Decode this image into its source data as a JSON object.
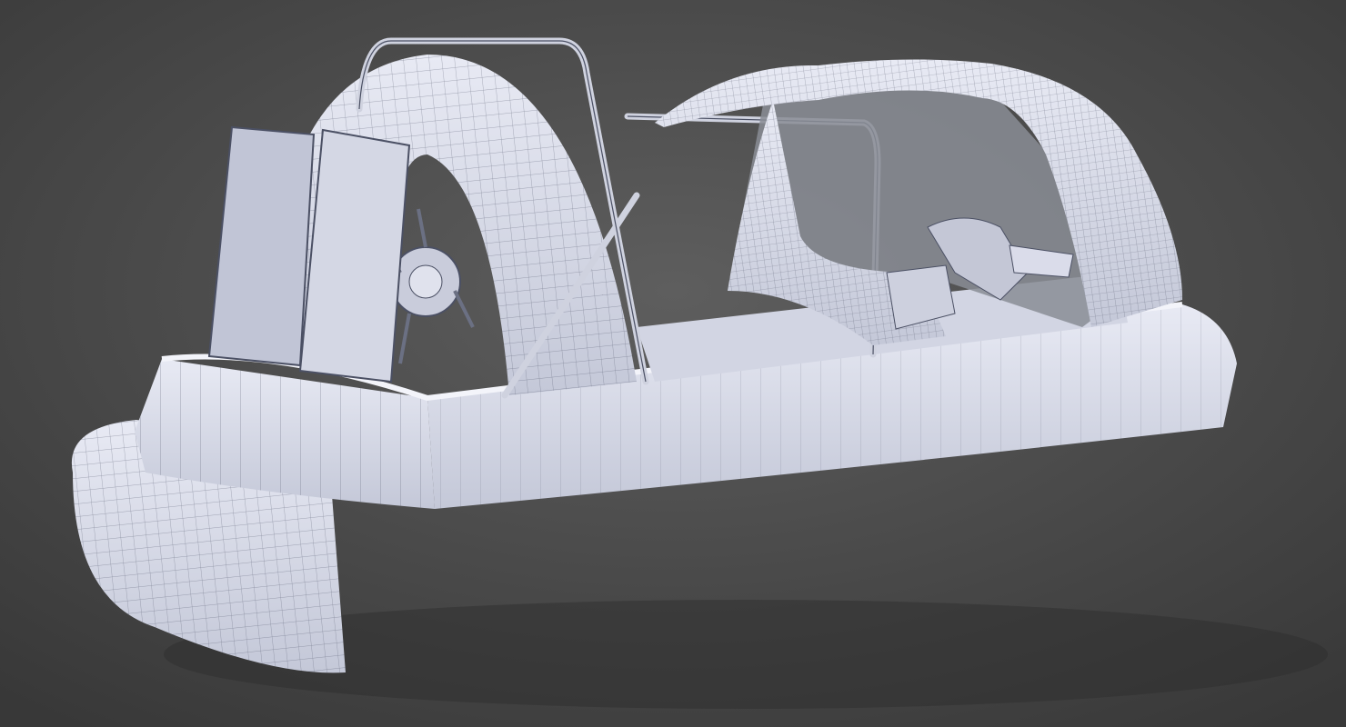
{
  "scene": {
    "subject": "hovercraft",
    "colors": {
      "background_center": "#5c5c5c",
      "background_edge": "#3c3c3c",
      "surface": "#dfe2ef",
      "surface_shade": "#b9bdcf",
      "wire": "#4b5064",
      "glass": "#8a8d95"
    },
    "skirt_lobe_count": 20
  }
}
